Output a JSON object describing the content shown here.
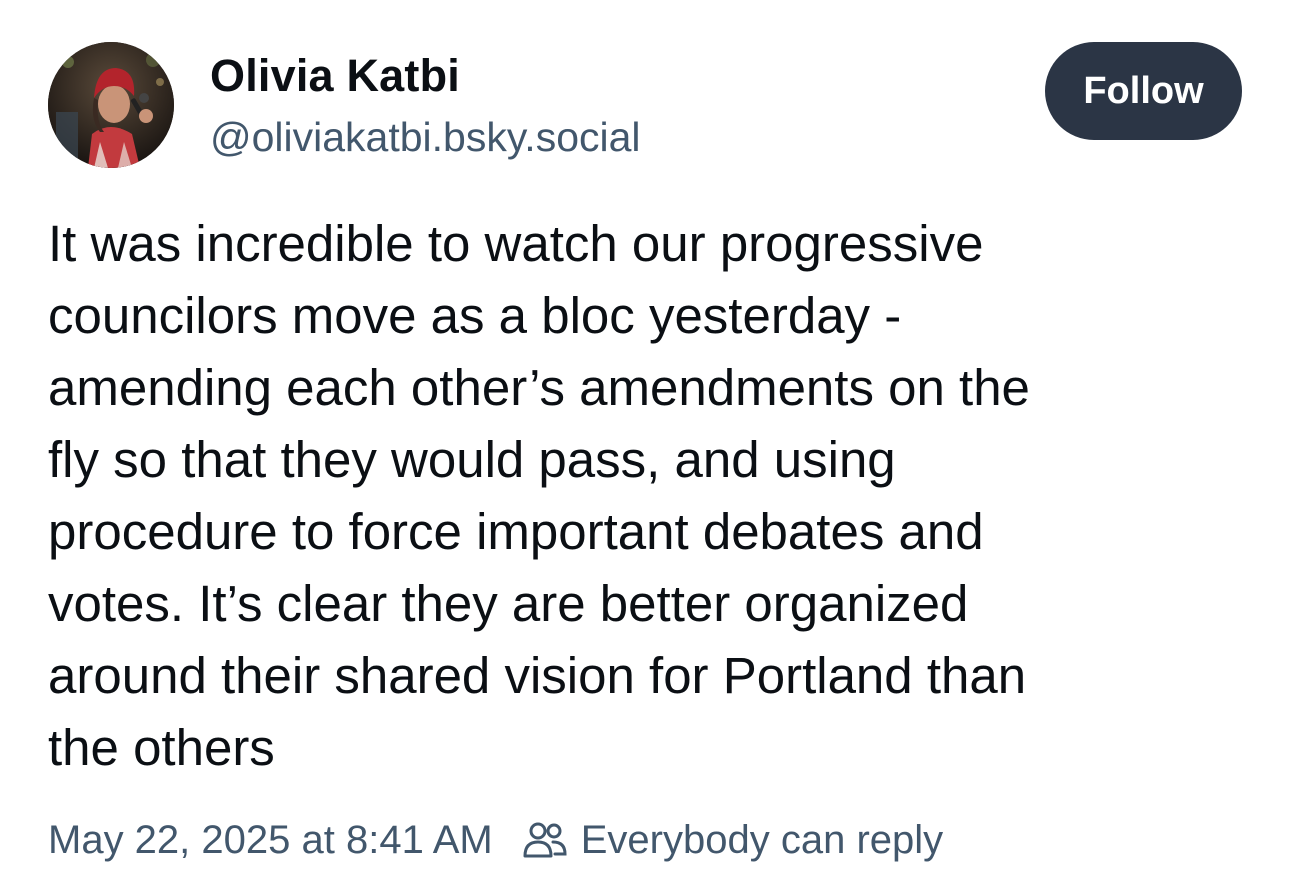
{
  "author": {
    "display_name": "Olivia Katbi",
    "handle": "@oliviakatbi.bsky.social",
    "avatar_icon": "profile-photo"
  },
  "follow_button": {
    "label": "Follow",
    "bg_color": "#2b3545",
    "text_color": "#ffffff"
  },
  "post": {
    "text_lines": [
      "It was incredible to watch our progressive",
      "councilors move as a bloc yesterday -",
      "amending each other’s amendments on the",
      "fly so that they would pass, and using",
      "procedure to force important debates and",
      "votes. It’s clear they are better organized",
      "around their shared vision for Portland than",
      "the others"
    ]
  },
  "meta": {
    "timestamp": "May 22, 2025 at 8:41 AM",
    "reply_setting_icon": "people-icon",
    "reply_setting": "Everybody can reply"
  },
  "colors": {
    "text_primary": "#0b0f14",
    "text_secondary": "#42576c"
  }
}
